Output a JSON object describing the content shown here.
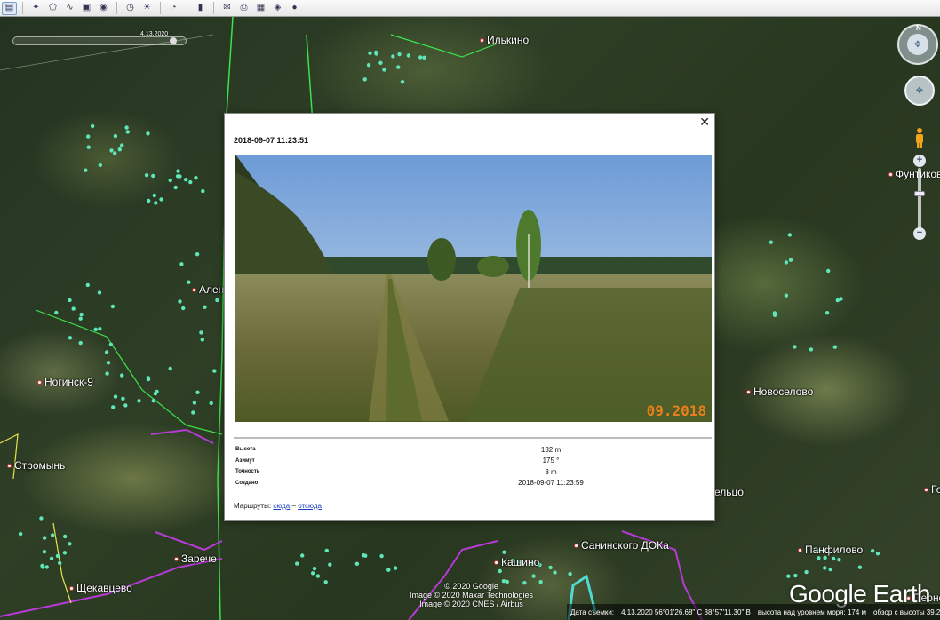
{
  "toolbar": {
    "buttons": [
      {
        "icon": "sidebar-toggle-icon",
        "active": true
      },
      {
        "icon": "placemark-icon"
      },
      {
        "icon": "polygon-icon"
      },
      {
        "icon": "path-icon"
      },
      {
        "icon": "image-overlay-icon"
      },
      {
        "icon": "record-tour-icon"
      },
      {
        "icon": "historical-imagery-icon"
      },
      {
        "icon": "sunlight-icon"
      },
      {
        "icon": "planets-icon"
      },
      {
        "icon": "ruler-icon"
      },
      {
        "icon": "email-icon"
      },
      {
        "icon": "print-icon"
      },
      {
        "icon": "save-image-icon"
      },
      {
        "icon": "google-maps-icon"
      },
      {
        "icon": "earth-icon"
      }
    ]
  },
  "timeline": {
    "date": "4.13.2020"
  },
  "places": [
    {
      "name": "Илькино"
    },
    {
      "name": "Фунтикова"
    },
    {
      "name": "Алень"
    },
    {
      "name": "Ногинск-9"
    },
    {
      "name": "Стромынь"
    },
    {
      "name": "Новоселово"
    },
    {
      "name": "ельцо"
    },
    {
      "name": "Зарече"
    },
    {
      "name": "Щекавцево"
    },
    {
      "name": "Санинского ДОКа"
    },
    {
      "name": "Кашино"
    },
    {
      "name": "Панфилово"
    },
    {
      "name": "Перно"
    },
    {
      "name": "Го"
    }
  ],
  "popup": {
    "title": "2018-09-07 11:23:51",
    "photo_stamp": "09.2018",
    "properties": [
      {
        "key": "Высота",
        "value": "132 m"
      },
      {
        "key": "Азимут",
        "value": "175 °"
      },
      {
        "key": "Точность",
        "value": "3 m"
      },
      {
        "key": "Создано",
        "value": "2018-09-07 11:23:59"
      }
    ],
    "routes_label": "Маршруты:",
    "route_to": "сюда",
    "route_sep": "–",
    "route_from": "отсюда"
  },
  "credits": {
    "line1": "© 2020 Google",
    "line2": "Image © 2020 Maxar Technologies",
    "line3": "Image © 2020 CNES / Airbus"
  },
  "brand": "Google Earth",
  "status": {
    "date_label": "Дата съемки:",
    "coords": "4.13.2020   56°01'26.68\" С   38°57'11.30\" В",
    "elevation": "высота над уровнем моря:   174 м",
    "eye_alt": "обзор с высоты   39.24 км"
  },
  "colors": {
    "route_magenta": "#b63ad6",
    "route_green": "#3fd24a",
    "route_cyan": "#4fd9d0",
    "dot_teal": "#5fe6b8",
    "photo_stamp": "#e77f1a",
    "link": "#1a3fc6"
  }
}
